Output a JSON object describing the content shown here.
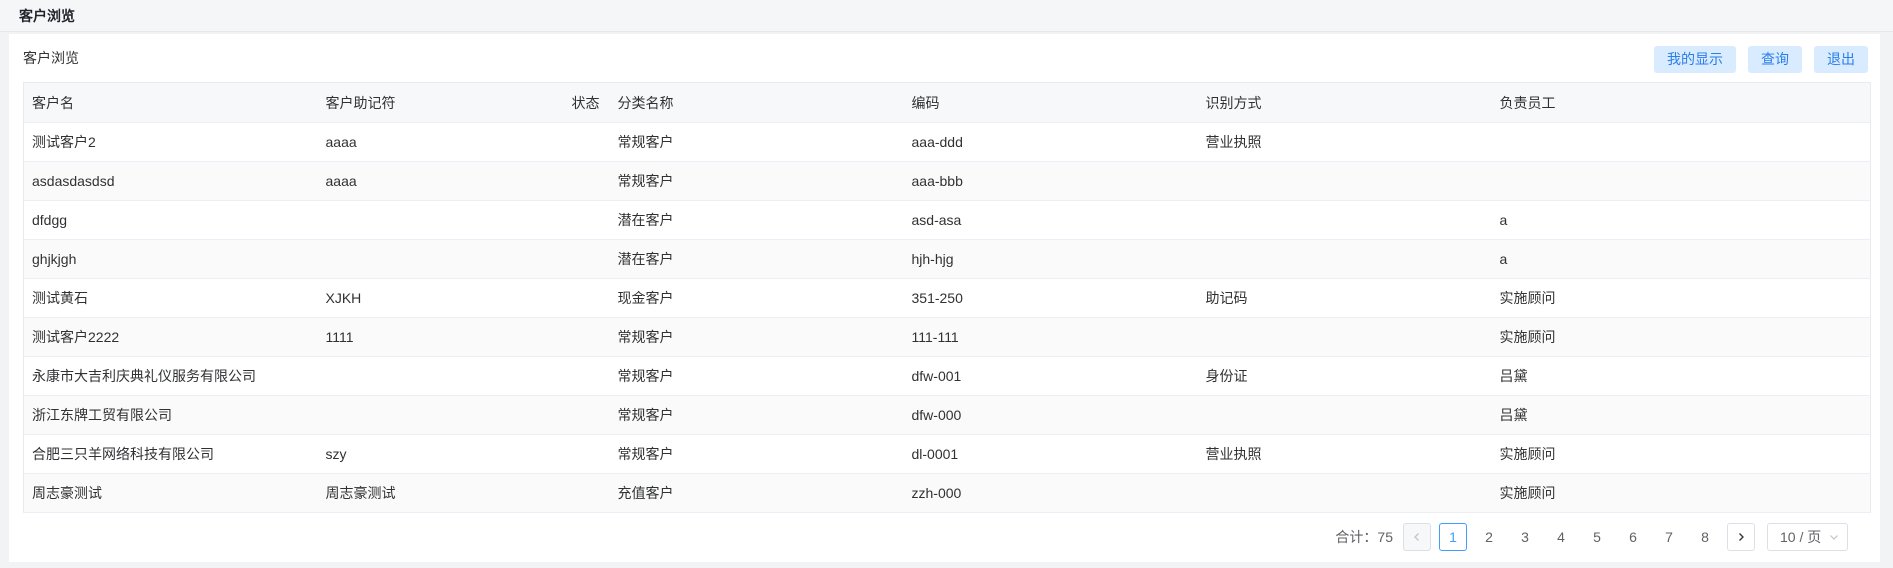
{
  "header": {
    "title": "客户浏览"
  },
  "card": {
    "title": "客户浏览"
  },
  "toolbar": {
    "my_display": "我的显示",
    "query": "查询",
    "exit": "退出"
  },
  "table": {
    "columns": [
      "客户名",
      "客户助记符",
      "状态",
      "分类名称",
      "编码",
      "识别方式",
      "负责员工"
    ],
    "rows": [
      [
        "测试客户2",
        "aaaa",
        "",
        "常规客户",
        "aaa-ddd",
        "营业执照",
        ""
      ],
      [
        "asdasdasdsd",
        "aaaa",
        "",
        "常规客户",
        "aaa-bbb",
        "",
        ""
      ],
      [
        "dfdgg",
        "",
        "",
        "潜在客户",
        "asd-asa",
        "",
        "a"
      ],
      [
        "ghjkjgh",
        "",
        "",
        "潜在客户",
        "hjh-hjg",
        "",
        "a"
      ],
      [
        "测试黄石",
        "XJKH",
        "",
        "现金客户",
        "351-250",
        "助记码",
        "实施顾问"
      ],
      [
        "测试客户2222",
        "1111",
        "",
        "常规客户",
        "111-111",
        "",
        "实施顾问"
      ],
      [
        "永康市大吉利庆典礼仪服务有限公司",
        "",
        "",
        "常规客户",
        "dfw-001",
        "身份证",
        "吕黛"
      ],
      [
        "浙江东牌工贸有限公司",
        "",
        "",
        "常规客户",
        "dfw-000",
        "",
        "吕黛"
      ],
      [
        "合肥三只羊网络科技有限公司",
        "szy",
        "",
        "常规客户",
        "dl-0001",
        "营业执照",
        "实施顾问"
      ],
      [
        "周志豪测试",
        "周志豪测试",
        "",
        "充值客户",
        "zzh-000",
        "",
        "实施顾问"
      ]
    ]
  },
  "pagination": {
    "total_label": "合计：",
    "total": "75",
    "pages": [
      "1",
      "2",
      "3",
      "4",
      "5",
      "6",
      "7",
      "8"
    ],
    "current": "1",
    "page_size": "10 / 页",
    "icons": {
      "prev": "chevron-left-icon",
      "next": "chevron-right-icon",
      "dropdown": "chevron-down-icon"
    }
  },
  "colors": {
    "accent": "#409eff",
    "button_bg": "#d9ecff",
    "button_text": "#2b7de9"
  }
}
